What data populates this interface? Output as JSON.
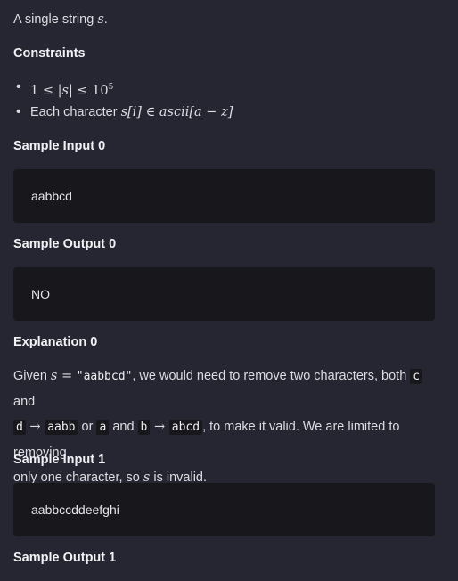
{
  "intro": {
    "text": "A single string ",
    "var": "s",
    "end": "."
  },
  "constraints": {
    "heading": "Constraints",
    "item1": {
      "math_prefix": "1 ≤ |",
      "var": "s",
      "math_mid": "| ≤ 10",
      "exp": "5"
    },
    "item2": {
      "text": "Each character ",
      "math": "s[i] ∈ ascii[a − z]"
    }
  },
  "samples": {
    "input0": {
      "heading": "Sample Input 0",
      "value": "aabbcd"
    },
    "output0": {
      "heading": "Sample Output 0",
      "value": "NO"
    },
    "explanation0": {
      "heading": "Explanation 0",
      "p1": "Given ",
      "var_s": "s",
      "eq": " = ",
      "str_code": "\"aabbcd\"",
      "p2": ", we would need to remove two characters, both ",
      "code_c": "c",
      "p3": " and",
      "code_d": "d",
      "arrow1": " → ",
      "code_aabb": "aabb",
      "p4": " or ",
      "code_a": "a",
      "p5": " and ",
      "code_b": "b",
      "arrow2": " → ",
      "code_abcd": "abcd",
      "p6": ", to make it valid. We are limited to removing",
      "p7": "only one character, so ",
      "var_s2": "s",
      "p8": " is invalid."
    },
    "input1": {
      "heading": "Sample Input 1",
      "value": "aabbccddeefghi"
    },
    "output1": {
      "heading": "Sample Output 1"
    }
  }
}
